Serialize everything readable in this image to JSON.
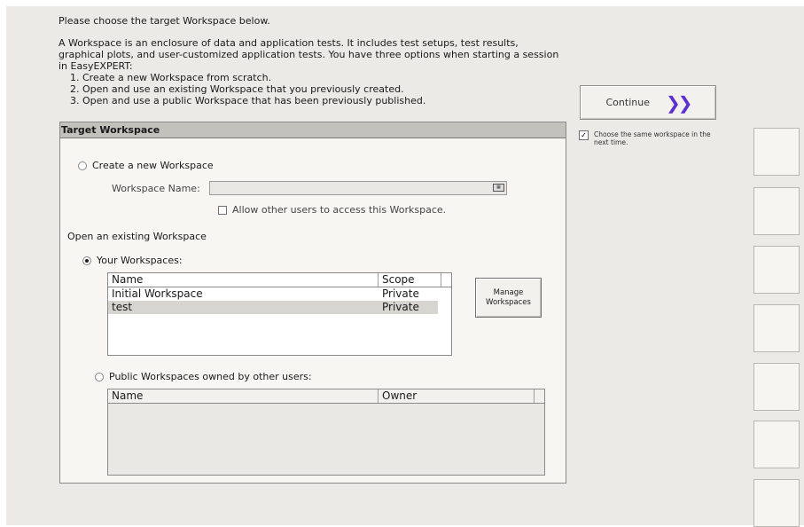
{
  "intro": {
    "choose_line": "Please choose the target Workspace below.",
    "paragraph": "A Workspace is an enclosure of data and application tests. It includes test setups, test results, graphical plots, and user-customized application tests. You have three options when starting a session in EasyEXPERT:",
    "steps": [
      "1. Create a new Workspace from scratch.",
      "2. Open and use an existing Workspace that you previously created.",
      "3. Open and use a public Workspace that has been previously published."
    ]
  },
  "continue_button": {
    "label": "Continue",
    "icon": "double-chevron-right-icon"
  },
  "same_workspace": {
    "checked": true,
    "label": "Choose the same workspace in the next time."
  },
  "target": {
    "header": "Target Workspace",
    "create_new": {
      "radio_label": "Create a new Workspace",
      "selected": false,
      "name_label": "Workspace Name:",
      "name_value": "",
      "allow_label": "Allow other users to access this Workspace.",
      "allow_checked": false,
      "keyboard_icon": "keyboard-icon"
    },
    "open_existing_label": "Open an existing Workspace",
    "your_workspaces": {
      "radio_label": "Your Workspaces:",
      "selected": true,
      "columns": [
        "Name",
        "Scope"
      ],
      "rows": [
        {
          "name": "Initial Workspace",
          "scope": "Private",
          "selected": false
        },
        {
          "name": "test",
          "scope": "Private",
          "selected": true
        }
      ],
      "manage_button_label": "Manage Workspaces"
    },
    "public_workspaces": {
      "radio_label": "Public Workspaces owned by other users:",
      "selected": false,
      "columns": [
        "Name",
        "Owner"
      ],
      "rows": []
    }
  }
}
